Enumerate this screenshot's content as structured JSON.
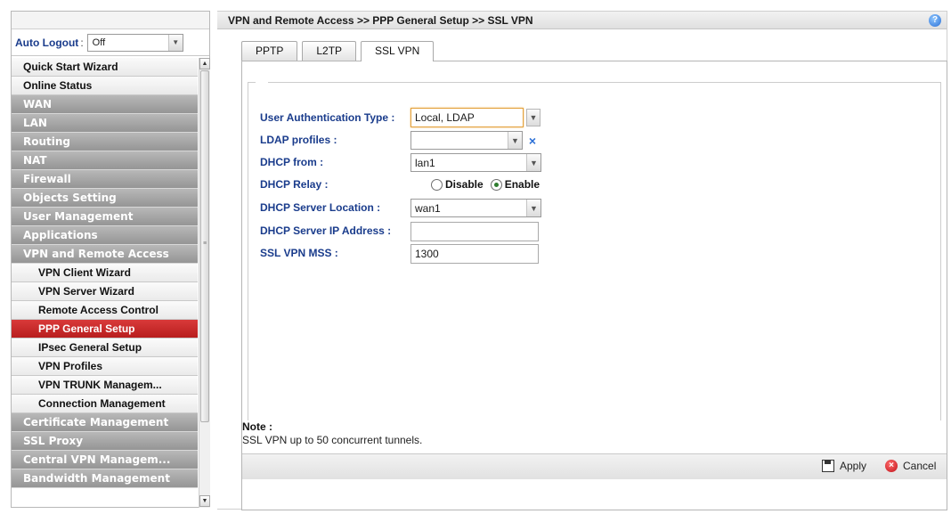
{
  "sidebar": {
    "auto_logout": {
      "label": "Auto Logout",
      "value": "Off"
    },
    "items": [
      {
        "label": "Quick Start Wizard"
      },
      {
        "label": "Online Status"
      },
      {
        "label": "WAN"
      },
      {
        "label": "LAN"
      },
      {
        "label": "Routing"
      },
      {
        "label": "NAT"
      },
      {
        "label": "Firewall"
      },
      {
        "label": "Objects Setting"
      },
      {
        "label": "User Management"
      },
      {
        "label": "Applications"
      },
      {
        "label": "VPN and Remote Access"
      },
      {
        "label": "VPN Client Wizard"
      },
      {
        "label": "VPN Server Wizard"
      },
      {
        "label": "Remote Access Control"
      },
      {
        "label": "PPP General Setup"
      },
      {
        "label": "IPsec General Setup"
      },
      {
        "label": "VPN Profiles"
      },
      {
        "label": "VPN TRUNK Managem..."
      },
      {
        "label": "Connection Management"
      },
      {
        "label": "Certificate Management"
      },
      {
        "label": "SSL Proxy"
      },
      {
        "label": "Central VPN Managem..."
      },
      {
        "label": "Bandwidth Management"
      }
    ]
  },
  "header": {
    "breadcrumb": "VPN and Remote Access >> PPP General Setup >> SSL VPN"
  },
  "tabs": [
    {
      "label": "PPTP"
    },
    {
      "label": "L2TP"
    },
    {
      "label": "SSL VPN"
    }
  ],
  "form": {
    "auth_type": {
      "label": "User Authentication Type",
      "value": "Local, LDAP"
    },
    "ldap_profiles": {
      "label": "LDAP profiles :",
      "value": ""
    },
    "dhcp_from": {
      "label": "DHCP from",
      "value": "lan1"
    },
    "dhcp_relay": {
      "label": "DHCP Relay",
      "option_disable": "Disable",
      "option_enable": "Enable",
      "selected": "Enable"
    },
    "dhcp_server_location": {
      "label": "DHCP Server Location",
      "value": "wan1"
    },
    "dhcp_server_ip": {
      "label": "DHCP Server IP Address :",
      "value": ""
    },
    "ssl_vpn_mss": {
      "label": "SSL VPN MSS :",
      "value": "1300"
    }
  },
  "note": {
    "title": "Note :",
    "text": "SSL VPN up to 50 concurrent tunnels."
  },
  "footer": {
    "apply_label": "Apply",
    "cancel_label": "Cancel"
  }
}
